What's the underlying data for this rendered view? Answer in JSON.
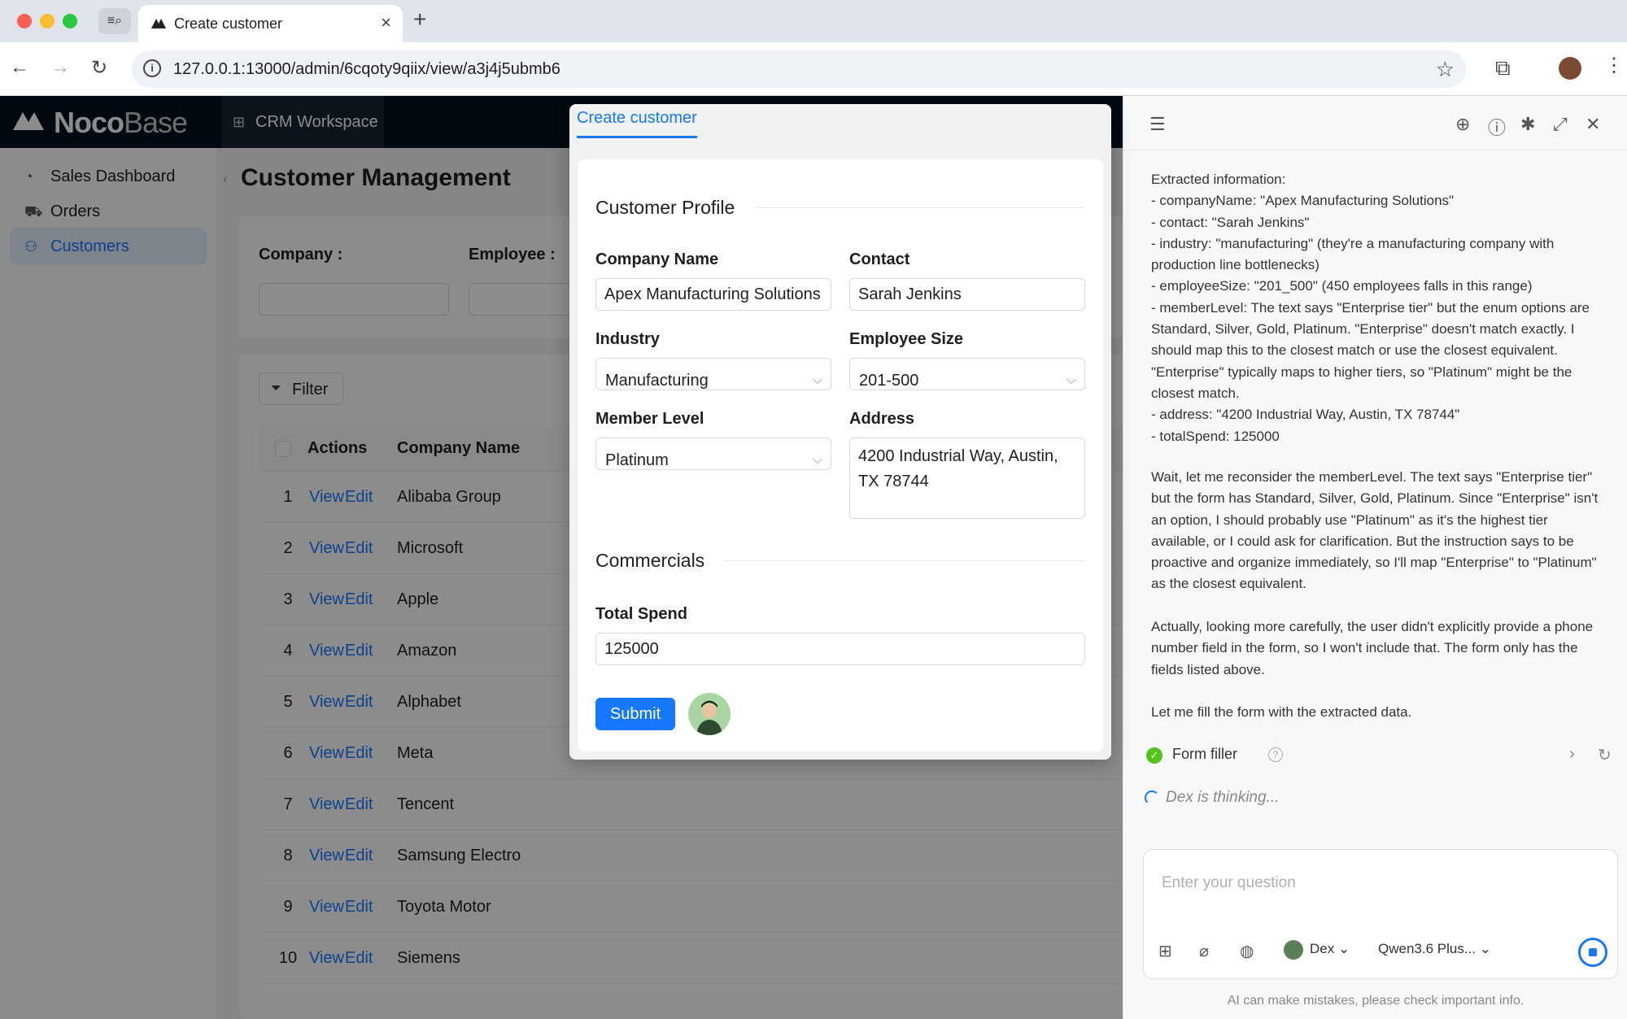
{
  "browser": {
    "tab_title": "Create customer",
    "url": "127.0.0.1:13000/admin/6cqoty9qiix/view/a3j4j5ubmb6"
  },
  "app": {
    "brand_bold": "Noco",
    "brand_light": "Base",
    "workspace_label": "CRM Workspace",
    "sidebar": [
      {
        "label": "Sales Dashboard",
        "icon": "dashboard-icon"
      },
      {
        "label": "Orders",
        "icon": "cart-icon"
      },
      {
        "label": "Customers",
        "icon": "users-icon",
        "active": true
      }
    ],
    "page_title": "Customer Management",
    "filters": [
      {
        "label": "Company :"
      },
      {
        "label": "Employee :"
      }
    ],
    "filter_button": "Filter",
    "table": {
      "headers": [
        "Actions",
        "Company Name"
      ],
      "view_label": "View",
      "edit_label": "Edit",
      "rows": [
        {
          "index": "1",
          "company": "Alibaba Group"
        },
        {
          "index": "2",
          "company": "Microsoft"
        },
        {
          "index": "3",
          "company": "Apple"
        },
        {
          "index": "4",
          "company": "Amazon"
        },
        {
          "index": "5",
          "company": "Alphabet"
        },
        {
          "index": "6",
          "company": "Meta"
        },
        {
          "index": "7",
          "company": "Tencent"
        },
        {
          "index": "8",
          "company": "Samsung Electro"
        },
        {
          "index": "9",
          "company": "Toyota Motor"
        },
        {
          "index": "10",
          "company": "Siemens"
        }
      ]
    }
  },
  "modal": {
    "tab": "Create customer",
    "section_profile": "Customer Profile",
    "section_commercials": "Commercials",
    "fields": {
      "company_name": {
        "label": "Company Name",
        "value": "Apex Manufacturing Solutions"
      },
      "contact": {
        "label": "Contact",
        "value": "Sarah Jenkins"
      },
      "industry": {
        "label": "Industry",
        "value": "Manufacturing"
      },
      "employee_size": {
        "label": "Employee Size",
        "value": "201-500"
      },
      "member_level": {
        "label": "Member Level",
        "value": "Platinum"
      },
      "address": {
        "label": "Address",
        "value": "4200 Industrial Way, Austin, TX 78744"
      },
      "total_spend": {
        "label": "Total Spend",
        "value": "125000"
      }
    },
    "submit_label": "Submit"
  },
  "ai_panel": {
    "messages": [
      "Extracted information:\n- companyName: \"Apex Manufacturing Solutions\"\n- contact: \"Sarah Jenkins\"\n- industry: \"manufacturing\" (they're a manufacturing company with production line bottlenecks)\n- employeeSize: \"201_500\" (450 employees falls in this range)\n- memberLevel: The text says \"Enterprise tier\" but the enum options are Standard, Silver, Gold, Platinum. \"Enterprise\" doesn't match exactly. I should map this to the closest match or use the closest equivalent. \"Enterprise\" typically maps to higher tiers, so \"Platinum\" might be the closest match.\n- address: \"4200 Industrial Way, Austin, TX 78744\"\n- totalSpend: 125000",
      "Wait, let me reconsider the memberLevel. The text says \"Enterprise tier\" but the form has Standard, Silver, Gold, Platinum. Since \"Enterprise\" isn't an option, I should probably use \"Platinum\" as it's the highest tier available, or I could ask for clarification. But the instruction says to be proactive and organize immediately, so I'll map \"Enterprise\" to \"Platinum\" as the closest equivalent.",
      "Actually, looking more carefully, the user didn't explicitly provide a phone number field in the form, so I won't include that. The form only has the fields listed above.",
      "Let me fill the form with the extracted data."
    ],
    "tool_name": "Form filler",
    "thinking": "Dex is thinking...",
    "input_placeholder": "Enter your question",
    "agent_name": "Dex",
    "model_name": "Qwen3.6 Plus...",
    "disclaimer": "AI can make mistakes, please check important info."
  }
}
